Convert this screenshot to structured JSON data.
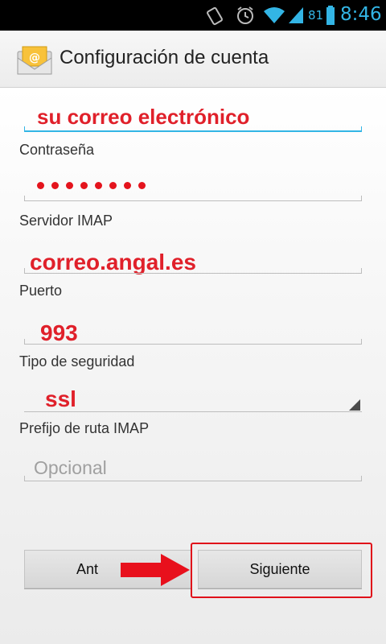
{
  "status_bar": {
    "battery_percent": "81",
    "time": "8:46",
    "icons": [
      "vibrate-icon",
      "alarm-icon",
      "wifi-icon",
      "signal-icon",
      "battery-icon"
    ]
  },
  "action_bar": {
    "title": "Configuración de cuenta",
    "icon": "email-icon"
  },
  "form": {
    "email_value": "su correo electrónico",
    "password_label": "Contraseña",
    "password_masked_count": 8,
    "server_label": "Servidor IMAP",
    "server_value": "correo.angal.es",
    "port_label": "Puerto",
    "port_value": "993",
    "security_label": "Tipo de seguridad",
    "security_value": "ssl",
    "prefix_label": "Prefijo de ruta IMAP",
    "prefix_placeholder": "Opcional"
  },
  "buttons": {
    "previous_label": "Ant",
    "next_label": "Siguiente"
  },
  "colors": {
    "accent": "#33b5e5",
    "annotation_red": "#e0202a"
  }
}
